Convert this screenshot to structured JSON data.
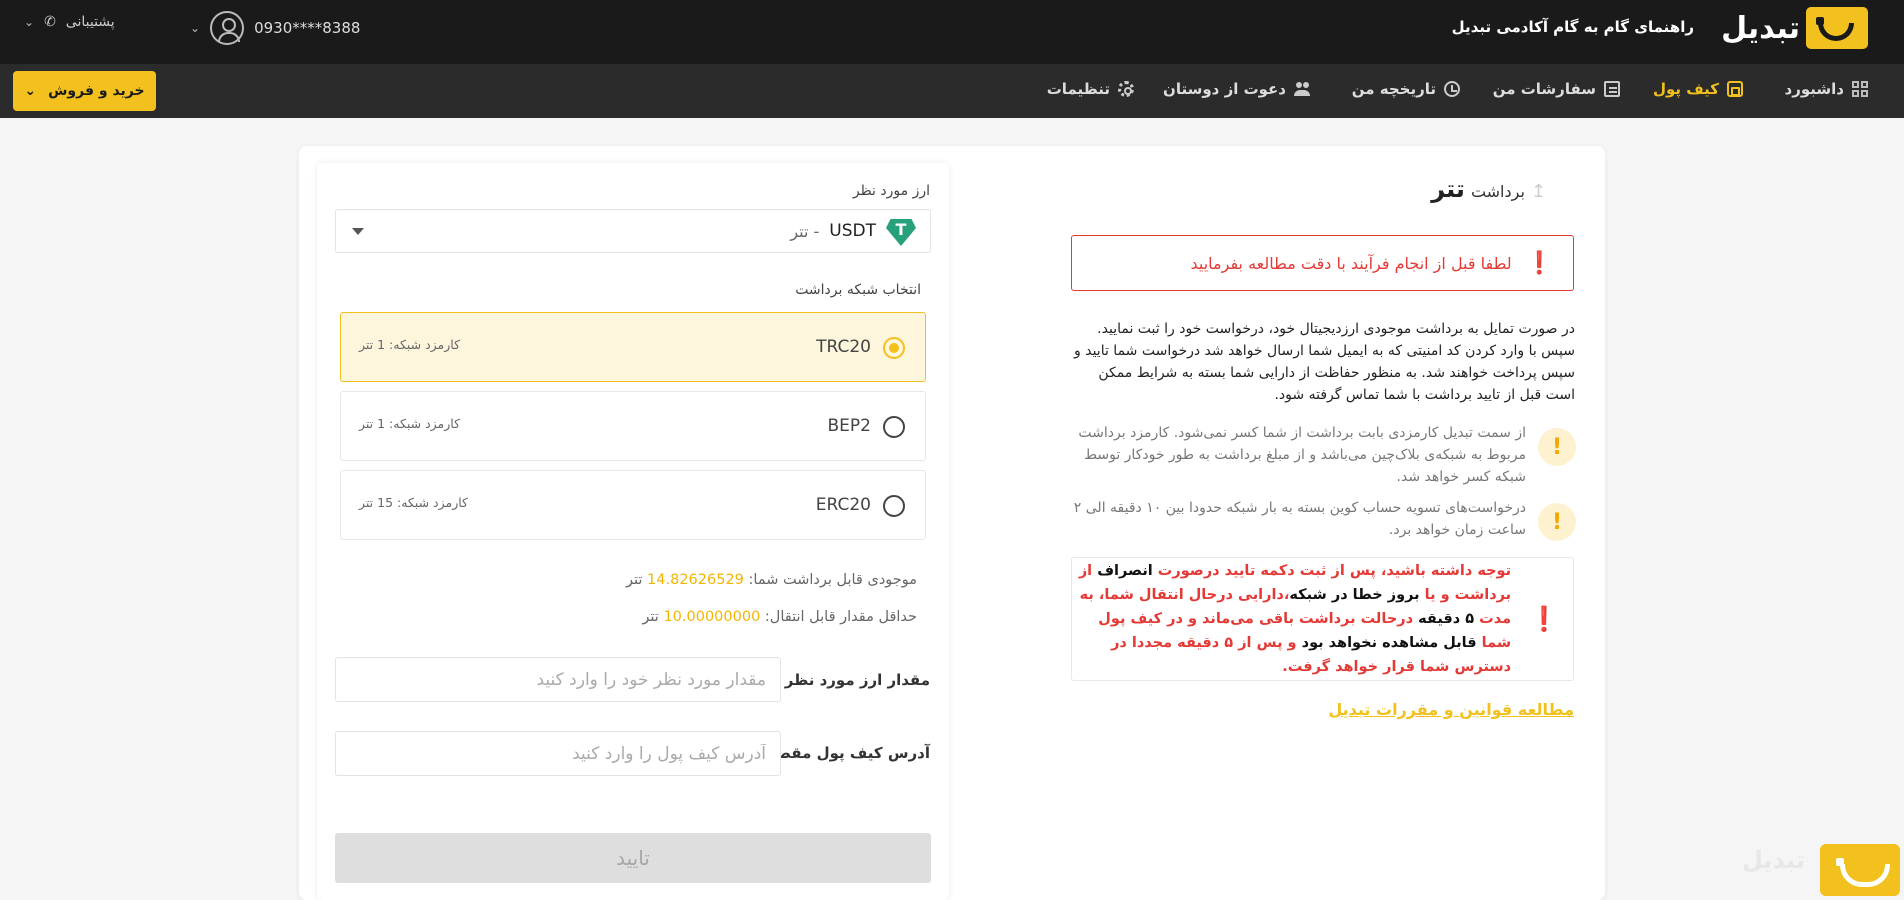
{
  "topbar": {
    "logo_text": "تبدیل",
    "nav": [
      "راهنمای گام به گام",
      "آکادمی تبدیل"
    ],
    "phone": "0930****8388",
    "support": "پشتیبانی"
  },
  "navbar": {
    "items": [
      {
        "label": "داشبورد",
        "icon": "dashboard-icon",
        "active": false
      },
      {
        "label": "کیف پول",
        "icon": "wallet-icon",
        "active": true
      },
      {
        "label": "سفارشات من",
        "icon": "orders-icon",
        "active": false
      },
      {
        "label": "تاریخچه من",
        "icon": "history-icon",
        "active": false
      },
      {
        "label": "دعوت از دوستان",
        "icon": "users-icon",
        "active": false
      },
      {
        "label": "تنظیمات",
        "icon": "gear-icon",
        "active": false
      }
    ],
    "buy_sell": "خرید و فروش"
  },
  "info": {
    "title_prefix": "برداشت",
    "title_coin": "تتر",
    "warning": "لطفا قبل از انجام فرآیند با دقت مطالعه بفرمایید",
    "paragraph": "در صورت تمایل به برداشت موجودی ارزدیجیتال خود، درخواست خود را ثبت نمایید. سپس با وارد کردن کد امنیتی که به ایمیل شما ارسال خواهد شد درخواست شما تایید و سپس پرداخت خواهند شد. به منظور حفاظت از دارایی شما بسته به شرایط ممکن است قبل از تایید برداشت با شما تماس گرفته شود.",
    "note1": "از سمت تبدیل کارمزدی بابت برداشت از شما کسر نمی‌شود. کارمزد برداشت مربوط به شبکه‌ی بلاک‌چین می‌باشد و از مبلغ برداشت به طور خودکار توسط شبکه کسر خواهد شد.",
    "note2": "درخواست‌های تسویه حساب کوین بسته به بار شبکه حدودا بین ۱۰ دقیقه الی ۲ ساعت زمان خواهد برد.",
    "alert": {
      "p1": "توجه داشته باشید، پس از ثبت دکمه تایید درصورت ",
      "b1": "انصراف",
      "p2": " از برداشت و یا ",
      "b2": "بروز خطا در شبکه",
      "p3": "،دارایی درحال انتقال شما، به مدت ",
      "b3": "۵ دقیقه",
      "p4": " درحالت برداشت باقی می‌ماند و در کیف پول شما ",
      "b4": "قابل مشاهده نخواهد بود",
      "p5": " و پس از ۵ دقیقه مجددا در دسترس شما قرار خواهد گرفت."
    },
    "rules_link": "مطالعه قوانین و مقررات تبدیل"
  },
  "form": {
    "currency_label": "ارز مورد نظر",
    "currency_code": "USDT",
    "currency_name": "- تتر",
    "network_label": "انتخاب شبکه برداشت",
    "networks": [
      {
        "name": "TRC20",
        "fee": "کارمزد شبکه: 1 تتر",
        "selected": true
      },
      {
        "name": "BEP2",
        "fee": "کارمزد شبکه: 1 تتر",
        "selected": false
      },
      {
        "name": "ERC20",
        "fee": "کارمزد شبکه: 15 تتر",
        "selected": false
      }
    ],
    "balance_label": "موجودی قابل برداشت شما:",
    "balance_value": "14.82626529",
    "balance_unit": "تتر",
    "min_label": "حداقل مقدار قابل انتقال:",
    "min_value": "10.00000000",
    "min_unit": "تتر",
    "amount_label": "مقدار ارز مورد نظر",
    "amount_placeholder": "مقدار مورد نظر خود را وارد کنید",
    "address_label": "آدرس کیف پول مقصد",
    "address_placeholder": "آدرس کیف پول را وارد کنید",
    "submit": "تایید"
  },
  "watermark": "تبدیل",
  "colors": {
    "brand": "#f2c11d",
    "danger": "#e53935",
    "topbar": "#1a1a1a",
    "navbar": "#2b2b2b"
  }
}
